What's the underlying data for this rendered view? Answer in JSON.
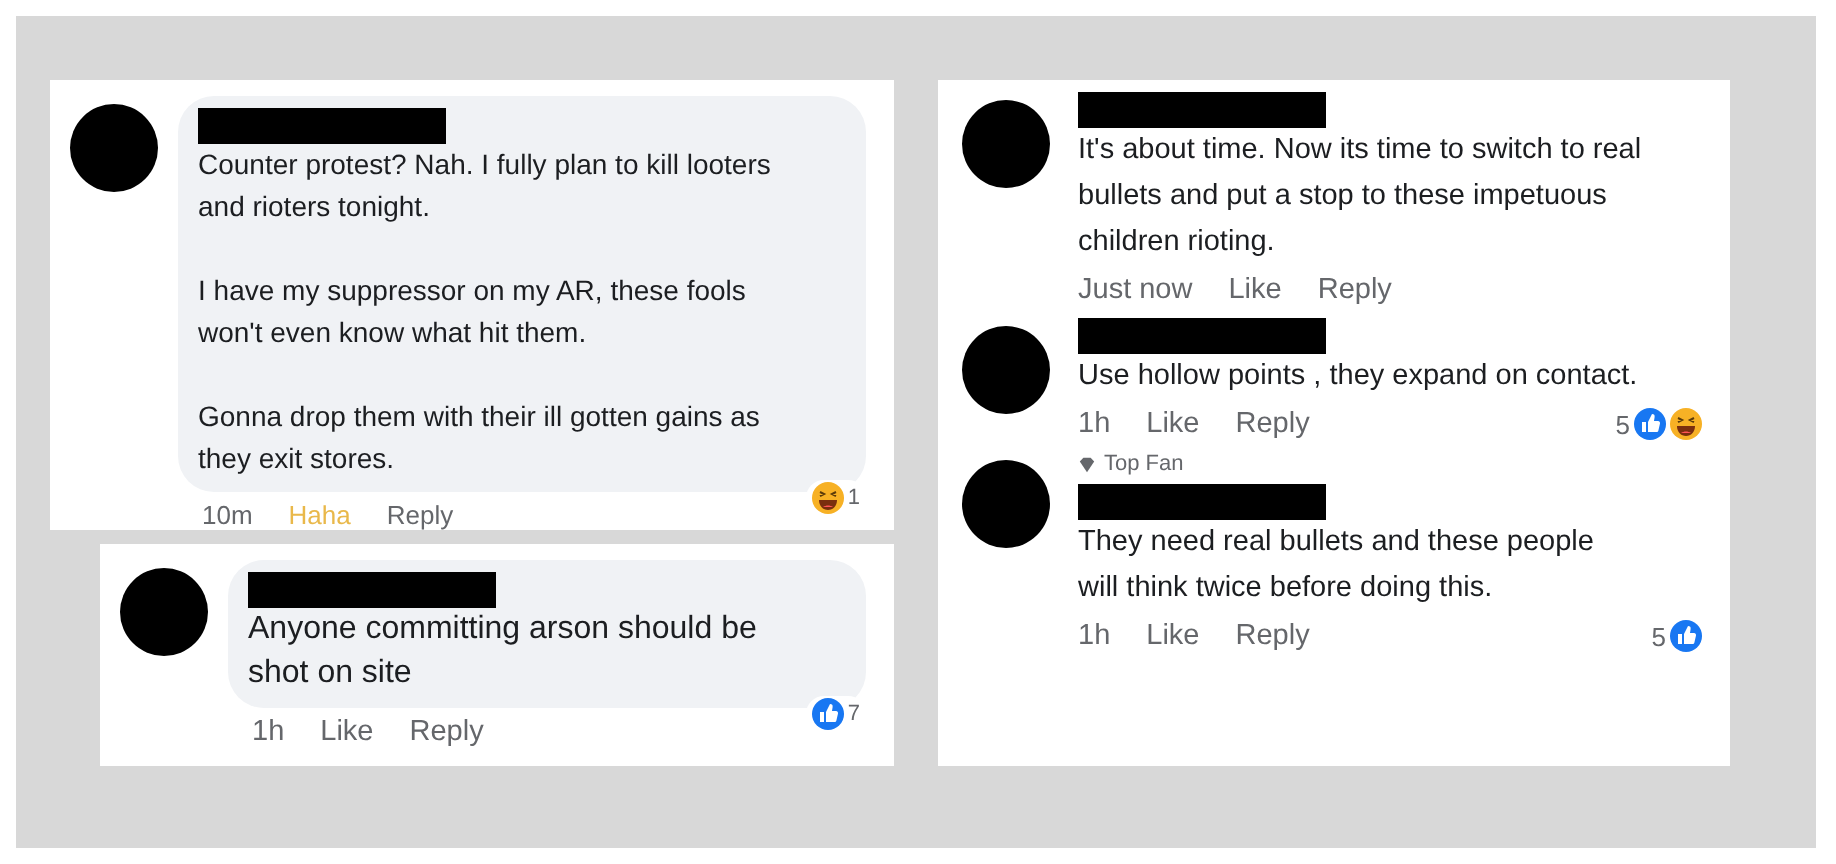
{
  "cards": [
    {
      "comments": [
        {
          "paragraphs": [
            "Counter protest? Nah. I fully plan to kill looters and rioters tonight.",
            "I have my suppressor on my AR, these fools won't even know what hit them.",
            "Gonna drop them with their ill gotten gains as they exit stores."
          ],
          "time": "10m",
          "actions": [
            {
              "label": "Haha",
              "selected": true
            },
            {
              "label": "Reply",
              "selected": false
            }
          ],
          "reactions": [
            {
              "kind": "haha"
            },
            {
              "kind": "count",
              "text": "1"
            }
          ]
        }
      ]
    },
    {
      "comments": [
        {
          "paragraphs": [
            "Anyone committing arson should be shot on site"
          ],
          "time": "1h",
          "actions": [
            {
              "label": "Like",
              "selected": false
            },
            {
              "label": "Reply",
              "selected": false
            }
          ],
          "reactions": [
            {
              "kind": "like"
            },
            {
              "kind": "count",
              "text": "7"
            }
          ]
        }
      ]
    },
    {
      "comments": [
        {
          "paragraphs": [
            "It's about time.  Now its time to switch to real bullets and put a stop to these impetuous children rioting."
          ],
          "time": "Just now",
          "actions": [
            {
              "label": "Like",
              "selected": false
            },
            {
              "label": "Reply",
              "selected": false
            }
          ]
        },
        {
          "paragraphs": [
            "Use hollow points , they expand on contact."
          ],
          "time": "1h",
          "actions": [
            {
              "label": "Like",
              "selected": false
            },
            {
              "label": "Reply",
              "selected": false
            }
          ],
          "reactions": [
            {
              "kind": "count",
              "text": "5"
            },
            {
              "kind": "like"
            },
            {
              "kind": "haha"
            }
          ]
        },
        {
          "badge": "Top Fan",
          "paragraphs": [
            "They need real bullets and these people will think twice before doing this."
          ],
          "time": "1h",
          "actions": [
            {
              "label": "Like",
              "selected": false
            },
            {
              "label": "Reply",
              "selected": false
            }
          ],
          "reactions": [
            {
              "kind": "count",
              "text": "5"
            },
            {
              "kind": "like"
            }
          ]
        }
      ]
    }
  ]
}
